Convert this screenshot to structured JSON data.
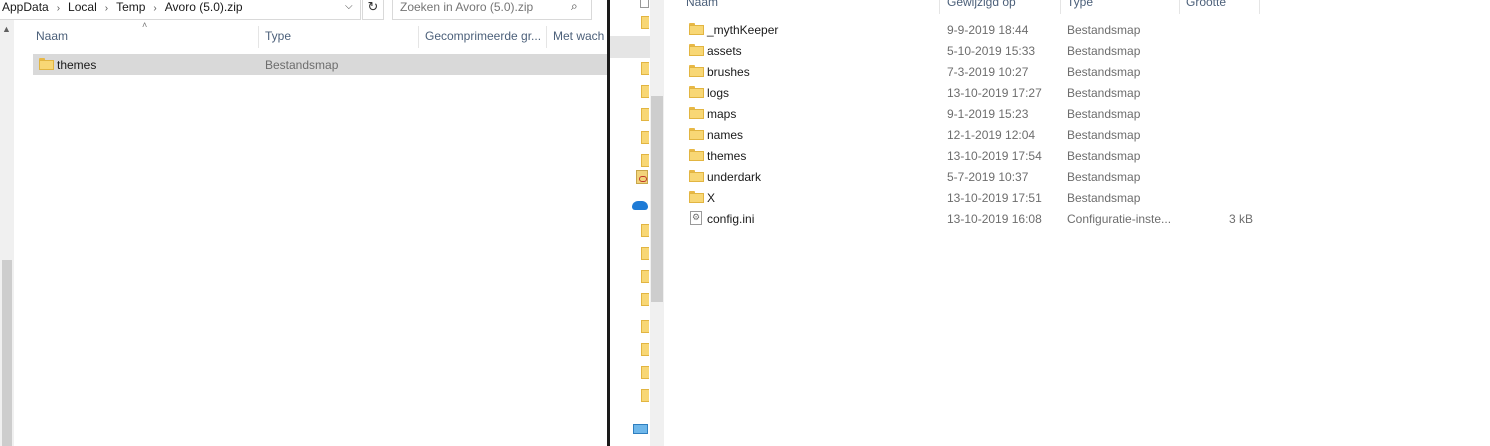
{
  "left_window": {
    "breadcrumb": [
      "AppData",
      "Local",
      "Temp",
      "Avoro (5.0).zip"
    ],
    "search_placeholder": "Zoeken in Avoro (5.0).zip",
    "columns": [
      "Naam",
      "Type",
      "Gecomprimeerde gr...",
      "Met wach"
    ],
    "rows": [
      {
        "name": "themes",
        "type": "Bestandsmap",
        "icon": "folder-icon",
        "selected": true
      }
    ]
  },
  "right_window": {
    "columns": [
      "Naam",
      "Gewijzigd op",
      "Type",
      "Grootte"
    ],
    "rows": [
      {
        "name": "_mythKeeper",
        "modified": "9-9-2019 18:44",
        "type": "Bestandsmap",
        "size": "",
        "icon": "folder-icon"
      },
      {
        "name": "assets",
        "modified": "5-10-2019 15:33",
        "type": "Bestandsmap",
        "size": "",
        "icon": "folder-icon"
      },
      {
        "name": "brushes",
        "modified": "7-3-2019 10:27",
        "type": "Bestandsmap",
        "size": "",
        "icon": "folder-icon"
      },
      {
        "name": "logs",
        "modified": "13-10-2019 17:27",
        "type": "Bestandsmap",
        "size": "",
        "icon": "folder-icon"
      },
      {
        "name": "maps",
        "modified": "9-1-2019 15:23",
        "type": "Bestandsmap",
        "size": "",
        "icon": "folder-icon"
      },
      {
        "name": "names",
        "modified": "12-1-2019 12:04",
        "type": "Bestandsmap",
        "size": "",
        "icon": "folder-icon"
      },
      {
        "name": "themes",
        "modified": "13-10-2019 17:54",
        "type": "Bestandsmap",
        "size": "",
        "icon": "folder-icon"
      },
      {
        "name": "underdark",
        "modified": "5-7-2019 10:37",
        "type": "Bestandsmap",
        "size": "",
        "icon": "folder-icon"
      },
      {
        "name": "X",
        "modified": "13-10-2019 17:51",
        "type": "Bestandsmap",
        "size": "",
        "icon": "folder-icon"
      },
      {
        "name": "config.ini",
        "modified": "13-10-2019 16:08",
        "type": "Configuratie-inste...",
        "size": "3 kB",
        "icon": "settings-file-icon"
      }
    ]
  },
  "colors": {
    "selection": "#d9d9d9",
    "header_text": "#4c607a",
    "folder": "#f8d775",
    "divider": "#1a1a1a"
  }
}
